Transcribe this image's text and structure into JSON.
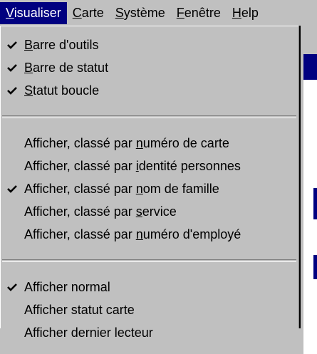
{
  "menubar": {
    "items": [
      {
        "label": "Visualiser",
        "mnemonic": "V",
        "rest": "isualiser",
        "active": true
      },
      {
        "label": "Carte",
        "mnemonic": "C",
        "rest": "arte"
      },
      {
        "label": "Système",
        "mnemonic": "S",
        "rest": "ystème"
      },
      {
        "label": "Fenêtre",
        "mnemonic": "F",
        "rest": "enêtre"
      },
      {
        "label": "Help",
        "mnemonic": "H",
        "rest": "elp"
      }
    ]
  },
  "menu": {
    "sections": [
      [
        {
          "label": "Barre d'outils",
          "pre": "",
          "mnemonic": "B",
          "post": "arre d'outils",
          "checked": true
        },
        {
          "label": "Barre de statut",
          "pre": "",
          "mnemonic": "B",
          "post": "arre de statut",
          "checked": true
        },
        {
          "label": "Statut boucle",
          "pre": "",
          "mnemonic": "S",
          "post": "tatut boucle",
          "checked": true
        }
      ],
      [
        {
          "label": "Afficher, classé par numéro de carte",
          "pre": "Afficher, classé par ",
          "mnemonic": "n",
          "post": "uméro de carte",
          "checked": false
        },
        {
          "label": "Afficher, classé par identité personnes",
          "pre": "Afficher, classé par ",
          "mnemonic": "i",
          "post": "dentité personnes",
          "checked": false
        },
        {
          "label": "Afficher, classé par nom de famille",
          "pre": "Afficher, classé par ",
          "mnemonic": "n",
          "post": "om de famille",
          "checked": true
        },
        {
          "label": "Afficher, classé par service",
          "pre": "Afficher, classé par ",
          "mnemonic": "s",
          "post": "ervice",
          "checked": false
        },
        {
          "label": "Afficher, classé par numéro d'employé",
          "pre": "Afficher, classé par ",
          "mnemonic": "n",
          "post": "uméro d'employé",
          "checked": false
        }
      ],
      [
        {
          "label": "Afficher normal",
          "pre": "Afficher normal",
          "mnemonic": "",
          "post": "",
          "checked": true
        },
        {
          "label": "Afficher statut carte",
          "pre": "Afficher statut carte",
          "mnemonic": "",
          "post": "",
          "checked": false
        },
        {
          "label": "Afficher dernier lecteur",
          "pre": "Afficher dernier lecteur",
          "mnemonic": "",
          "post": "",
          "checked": false
        }
      ]
    ]
  },
  "icons": {
    "check": "checkmark-icon"
  },
  "colors": {
    "face": "#c0c0c0",
    "highlight_bg": "#000080",
    "highlight_text": "#ffffff",
    "text": "#000000"
  }
}
